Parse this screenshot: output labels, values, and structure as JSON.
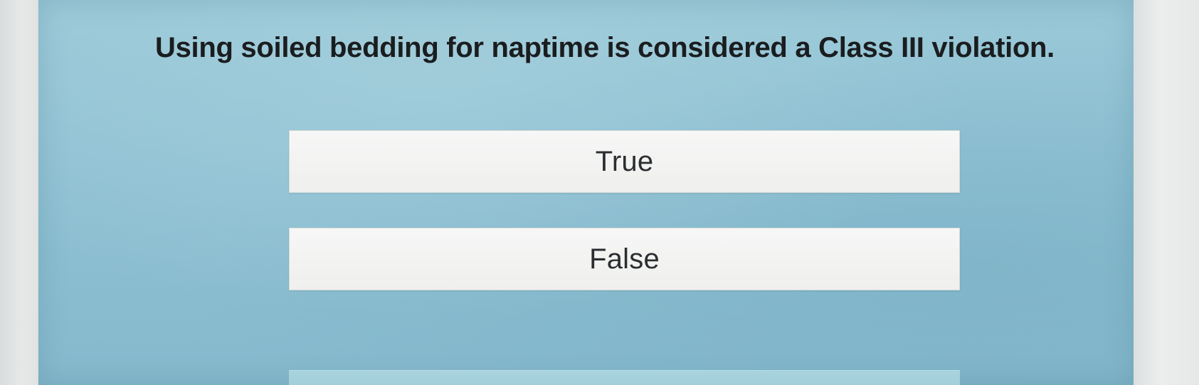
{
  "question": {
    "text": "Using soiled bedding for naptime is considered a Class III violation."
  },
  "options": [
    {
      "label": "True"
    },
    {
      "label": "False"
    }
  ],
  "colors": {
    "background": "#8fc1d3",
    "option_fill": "#f2f2f0",
    "text": "#1a1d1f"
  }
}
